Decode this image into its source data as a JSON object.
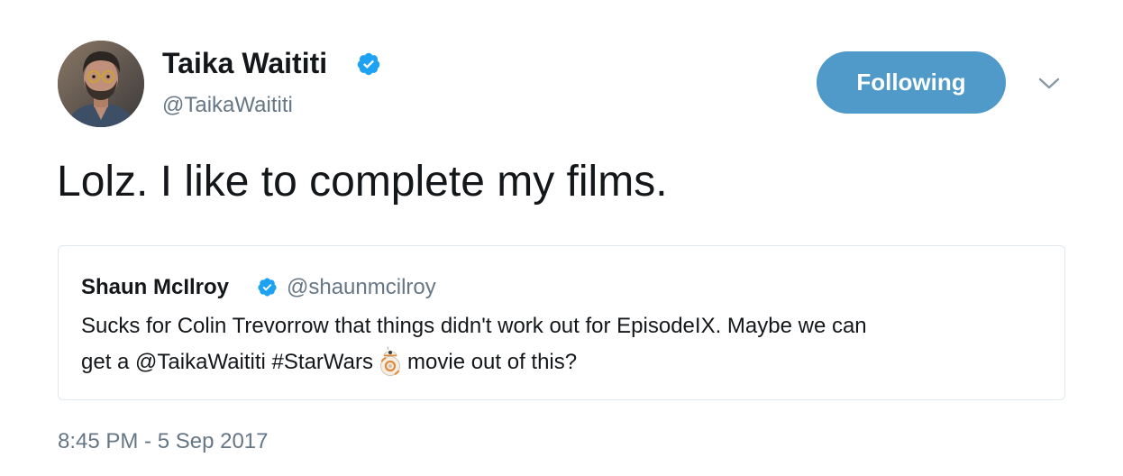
{
  "author": {
    "display_name": "Taika Waititi",
    "handle": "@TaikaWaititi",
    "verified": true
  },
  "follow_button": {
    "label": "Following"
  },
  "tweet": {
    "text": "Lolz. I like to complete my films."
  },
  "quoted_tweet": {
    "display_name": "Shaun McIlroy",
    "handle": "@shaunmcilroy",
    "line1": "Sucks for Colin Trevorrow that things didn't work out for EpisodeIX. Maybe we can",
    "line2_before_emoji": "get a @TaikaWaititi #StarWars",
    "line2_after_emoji": "movie out of this?",
    "emoji": "bb8-icon"
  },
  "timestamp": "8:45 PM - 5 Sep 2017",
  "colors": {
    "follow_button_bg": "#4f9ac8",
    "verified_badge": "#1da1f2",
    "secondary_text": "#657786",
    "primary_text": "#14171a",
    "quote_border": "#e1e8ed"
  }
}
